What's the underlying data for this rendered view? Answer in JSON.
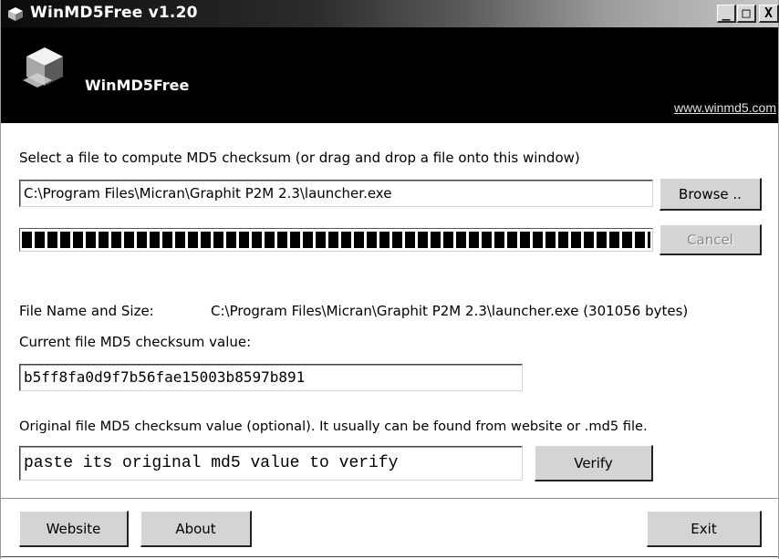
{
  "window": {
    "title": "WinMD5Free v1.20",
    "minimize_glyph": "_",
    "maximize_glyph": "□",
    "close_glyph": "X"
  },
  "header": {
    "app_name": "WinMD5Free",
    "website_link": "www.winmd5.com"
  },
  "file_section": {
    "instruction": "Select a file to compute MD5 checksum (or drag and drop a file onto this window)",
    "file_path_value": "C:\\Program Files\\Micran\\Graphit P2M 2.3\\launcher.exe",
    "browse_label": "Browse ..",
    "cancel_label": "Cancel",
    "progress_percent": 100
  },
  "result_section": {
    "file_name_size_label": "File Name and Size:",
    "file_name_size_value": "C:\\Program Files\\Micran\\Graphit P2M 2.3\\launcher.exe (301056 bytes)",
    "current_md5_label": "Current file MD5 checksum value:",
    "current_md5_value": "b5ff8fa0d9f7b56fae15003b8597b891"
  },
  "verify_section": {
    "original_md5_label": "Original file MD5 checksum value (optional). It usually can be found from website or .md5 file.",
    "original_md5_placeholder": "paste its original md5 value to verify",
    "verify_label": "Verify"
  },
  "footer": {
    "website_label": "Website",
    "about_label": "About",
    "exit_label": "Exit"
  },
  "icons": {
    "title_icon": "app-cube-icon",
    "logo": "md5-cube-logo-icon"
  },
  "colors": {
    "header_background": "#000000",
    "button_face": "#d4d4d4",
    "window_background": "#ffffff"
  }
}
